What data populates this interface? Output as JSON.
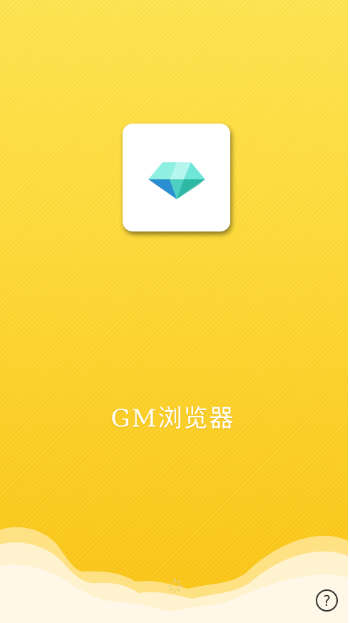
{
  "splash": {
    "app_name": "GM浏览器",
    "icon": "diamond-icon",
    "loading_icon": "loading-spinner-icon"
  },
  "help": {
    "label": "?",
    "icon": "help-icon"
  },
  "colors": {
    "background_top": "#ffe44f",
    "background_bottom": "#fbc414",
    "cloud": "#fff6dc",
    "title_text": "#ffffff",
    "diamond_teal": "#3fd6c4",
    "diamond_blue": "#1f6fb5"
  }
}
